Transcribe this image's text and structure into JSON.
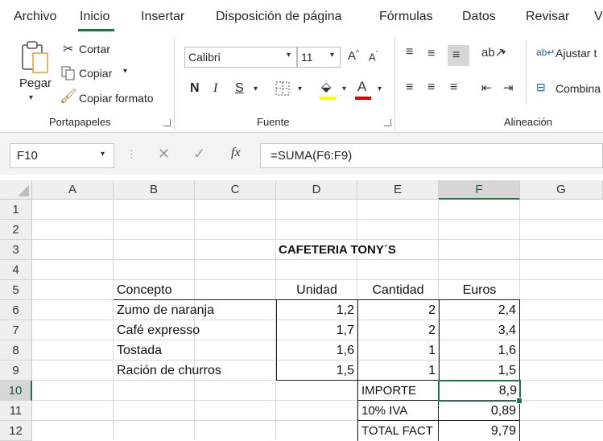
{
  "tabs": [
    "Archivo",
    "Inicio",
    "Insertar",
    "Disposición de página",
    "Fórmulas",
    "Datos",
    "Revisar",
    "V"
  ],
  "ribbon": {
    "clipboard": {
      "paste": "Pegar",
      "cut": "Cortar",
      "copy": "Copiar",
      "format_painter": "Copiar formato",
      "group": "Portapapeles"
    },
    "font": {
      "font_name": "Calibri",
      "font_size": "11",
      "bold": "N",
      "italic": "I",
      "underline": "S",
      "group": "Fuente",
      "highlight_color": "#ffff00",
      "font_color": "#e00000"
    },
    "alignment": {
      "wrap": "Ajustar t",
      "merge": "Combina",
      "group": "Alineación"
    }
  },
  "formula_bar": {
    "name_box": "F10",
    "fx": "fx",
    "formula": "=SUMA(F6:F9)"
  },
  "columns": [
    "A",
    "B",
    "C",
    "D",
    "E",
    "F",
    "G"
  ],
  "rows": [
    "1",
    "2",
    "3",
    "4",
    "5",
    "6",
    "7",
    "8",
    "9",
    "10",
    "11",
    "12"
  ],
  "sheet": {
    "title": "CAFETERIA TONY´S",
    "headers": {
      "concepto": "Concepto",
      "unidad": "Unidad",
      "cantidad": "Cantidad",
      "euros": "Euros"
    },
    "items": [
      {
        "concepto": "Zumo de naranja",
        "unidad": "1,2",
        "cantidad": "2",
        "euros": "2,4"
      },
      {
        "concepto": "Café expresso",
        "unidad": "1,7",
        "cantidad": "2",
        "euros": "3,4"
      },
      {
        "concepto": "Tostada",
        "unidad": "1,6",
        "cantidad": "1",
        "euros": "1,6"
      },
      {
        "concepto": "Ración de churros",
        "unidad": "1,5",
        "cantidad": "1",
        "euros": "1,5"
      }
    ],
    "totals": [
      {
        "label": "IMPORTE",
        "value": "8,9"
      },
      {
        "label": "10% IVA",
        "value": "0,89"
      },
      {
        "label": "TOTAL FACT",
        "value": "9,79"
      }
    ]
  },
  "accent": "#217346"
}
